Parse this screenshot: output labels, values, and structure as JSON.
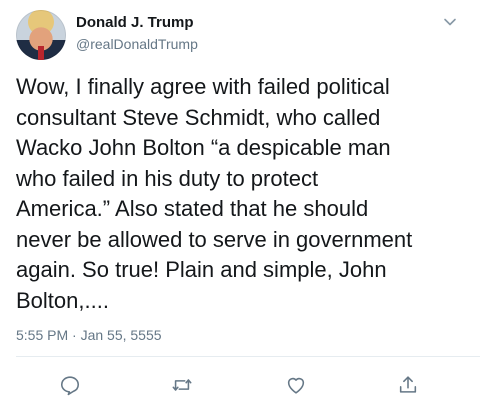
{
  "author": {
    "display_name": "Donald J. Trump",
    "handle": "@realDonaldTrump"
  },
  "tweet": {
    "text": "Wow, I finally agree with failed political\nconsultant Steve Schmidt, who called\nWacko John Bolton “a despicable man\nwho failed in his duty to protect\nAmerica.” Also stated that he should\nnever be allowed to serve in government\nagain. So true! Plain and simple, John\nBolton,....",
    "timestamp": "5:55 PM · Jan 55, 5555"
  },
  "icons": {
    "menu": "chevron-down-icon",
    "reply": "reply-icon",
    "retweet": "retweet-icon",
    "like": "like-icon",
    "share": "share-icon"
  },
  "colors": {
    "text": "#14171a",
    "secondary": "#657786",
    "icon": "#657786",
    "divider": "#e6ecf0"
  }
}
